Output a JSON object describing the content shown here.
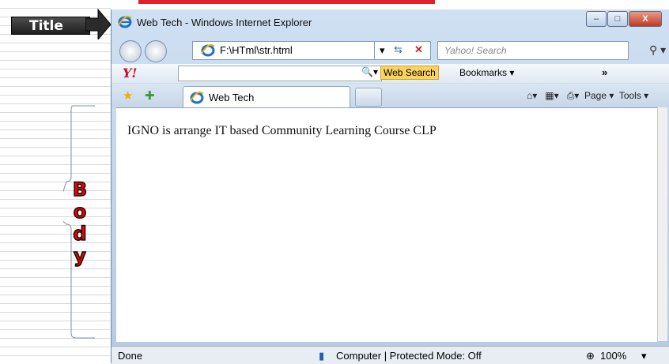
{
  "annotation": {
    "title_label": "Title",
    "body_letters": [
      "B",
      "o",
      "d",
      "y"
    ]
  },
  "window": {
    "title": "Web Tech - Windows Internet Explorer",
    "min": "–",
    "max": "□",
    "close": "X"
  },
  "address": {
    "url": "F:\\HTml\\str.html",
    "search_placeholder": "Yahoo! Search"
  },
  "yahoo": {
    "logo": "Y!",
    "web_search": "Web Search",
    "bookmarks": "Bookmarks ▾",
    "more": "»"
  },
  "tabs": [
    {
      "label": "Web Tech"
    }
  ],
  "command_bar": {
    "page": "Page ▾",
    "tools": "Tools ▾"
  },
  "page": {
    "text": "IGNO is arrange IT based Community Learning Course CLP"
  },
  "status": {
    "left": "Done",
    "zone": "Computer | Protected Mode: Off",
    "zoom": "100%"
  }
}
